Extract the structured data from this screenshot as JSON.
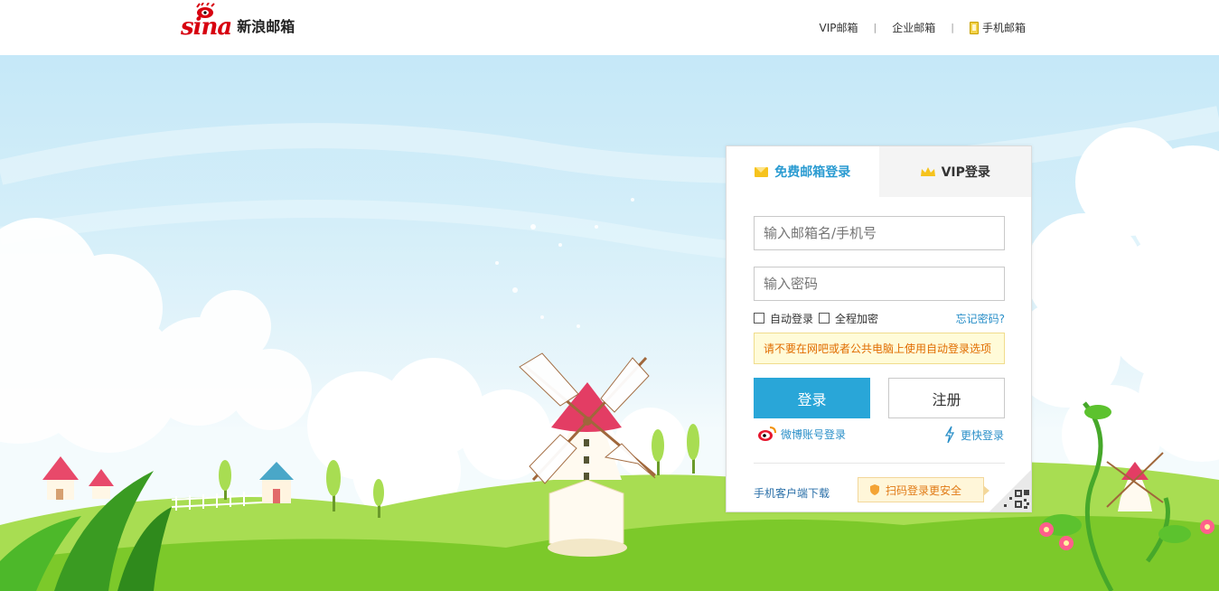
{
  "header": {
    "logo_brand": "sina",
    "logo_text": "新浪邮箱",
    "nav": [
      {
        "label": "VIP邮箱"
      },
      {
        "label": "企业邮箱"
      },
      {
        "label": "手机邮箱",
        "icon": "phone-icon"
      }
    ],
    "separator": "|"
  },
  "login": {
    "tabs": [
      {
        "label": "免费邮箱登录",
        "icon": "mail-icon",
        "active": true
      },
      {
        "label": "VIP登录",
        "icon": "crown-icon",
        "active": false
      }
    ],
    "username_placeholder": "输入邮箱名/手机号",
    "password_placeholder": "输入密码",
    "auto_login_label": "自动登录",
    "encrypt_label": "全程加密",
    "forgot_label": "忘记密码?",
    "notice": "请不要在网吧或者公共电脑上使用自动登录选项",
    "login_button": "登录",
    "register_button": "注册",
    "weibo_login": "微博账号登录",
    "fast_login": "更快登录",
    "mobile_download": "手机客户端下载",
    "qr_tip": "扫码登录更安全"
  },
  "colors": {
    "accent": "#29a6d8",
    "brand_red": "#d7000f",
    "link": "#2a8fc8",
    "notice_text": "#e06c00",
    "grass": "#8fd13b"
  }
}
